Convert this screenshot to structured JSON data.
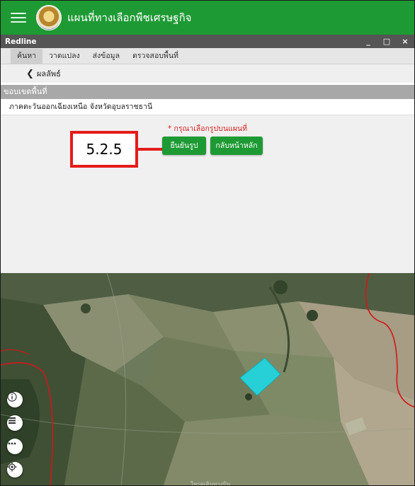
{
  "app": {
    "title": "แผนที่ทางเลือกพืชเศรษฐกิจ"
  },
  "window": {
    "title": "Redline",
    "minimize": "_",
    "maximize": "□",
    "close": "×"
  },
  "tabs": [
    {
      "label": "ค้นหา"
    },
    {
      "label": "วาดแปลง"
    },
    {
      "label": "ส่งข้อมูล"
    },
    {
      "label": "ตรวจสอบพื้นที่"
    }
  ],
  "back": {
    "label": "ผลลัพธ์"
  },
  "section": {
    "title": "ขอบเขตพื้นที่"
  },
  "region": {
    "text": "ภาคตะวันออกเฉียงเหนือ จังหวัดอุบลราชธานี"
  },
  "panel": {
    "hint": "* กรุณาเลือกรูปบนแผนที่",
    "confirm_label": "ยืนยันรูป",
    "home_label": "กลับหน้าหลัก"
  },
  "callout": {
    "label": "5.2.5"
  },
  "map": {
    "watermark": "ใหรดูเดินทางบิน",
    "buttons": [
      "info-icon",
      "list-icon",
      "more-icon",
      "locate-icon"
    ]
  },
  "colors": {
    "brand_green": "#1e9a34",
    "window_bar": "#555555",
    "callout_red": "#e51b1b",
    "selected_polygon": "#26d0d6",
    "boundary_line": "#d01818"
  }
}
